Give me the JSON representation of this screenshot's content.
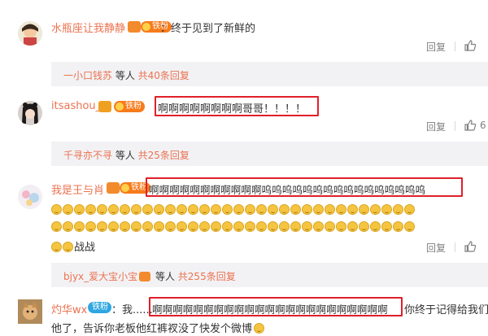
{
  "comments": [
    {
      "username": "水瓶座让我静静",
      "fan_badge": "铁粉",
      "text": "：终于见到了新鲜的",
      "reply_label": "回复",
      "like_count": "",
      "sub_replies": {
        "user": "一小口钱苏",
        "middle": " 等人 ",
        "count_text": "共40条回复"
      }
    },
    {
      "username": "itsashou_",
      "fan_badge": "铁粉",
      "text": "啊啊啊啊啊啊啊啊哥哥！！！！",
      "reply_label": "回复",
      "like_count": "6",
      "sub_replies": {
        "user": "千寻亦不寻",
        "middle": " 等人 ",
        "count_text": "共25条回复"
      }
    },
    {
      "username": "我是王与肖",
      "fan_badge": "铁粉",
      "text": "啊啊啊啊啊啊啊啊啊啊啊呜呜呜呜呜呜呜呜呜呜呜呜呜呜呜呜",
      "text_line3_tail": "战战",
      "reply_label": "回复",
      "like_count": "",
      "sub_replies": {
        "user": "bjyx_爱大宝小宝",
        "middle": " 等人 ",
        "count_text": "共255条回复"
      }
    },
    {
      "username": "灼华wx",
      "fan_badge": "铁粉",
      "prefix": "：我......",
      "text": "啊啊啊啊啊啊啊啊啊啊啊啊啊啊啊啊啊啊啊啊啊啊啊",
      "suffix": "你终于记得给我们",
      "line2": "他了，告诉你老板他红裤衩没了快发个微博"
    }
  ],
  "icons": {
    "like": "thumbs-up-icon",
    "vip": "vip-crown-icon",
    "fan": "fan-badge-icon",
    "emoji": "smile-emoji-icon"
  },
  "colors": {
    "username": "#eb7350",
    "highlight_box": "#e0202a",
    "sub_reply_bg": "#f2f2f5",
    "muted": "#808080"
  }
}
